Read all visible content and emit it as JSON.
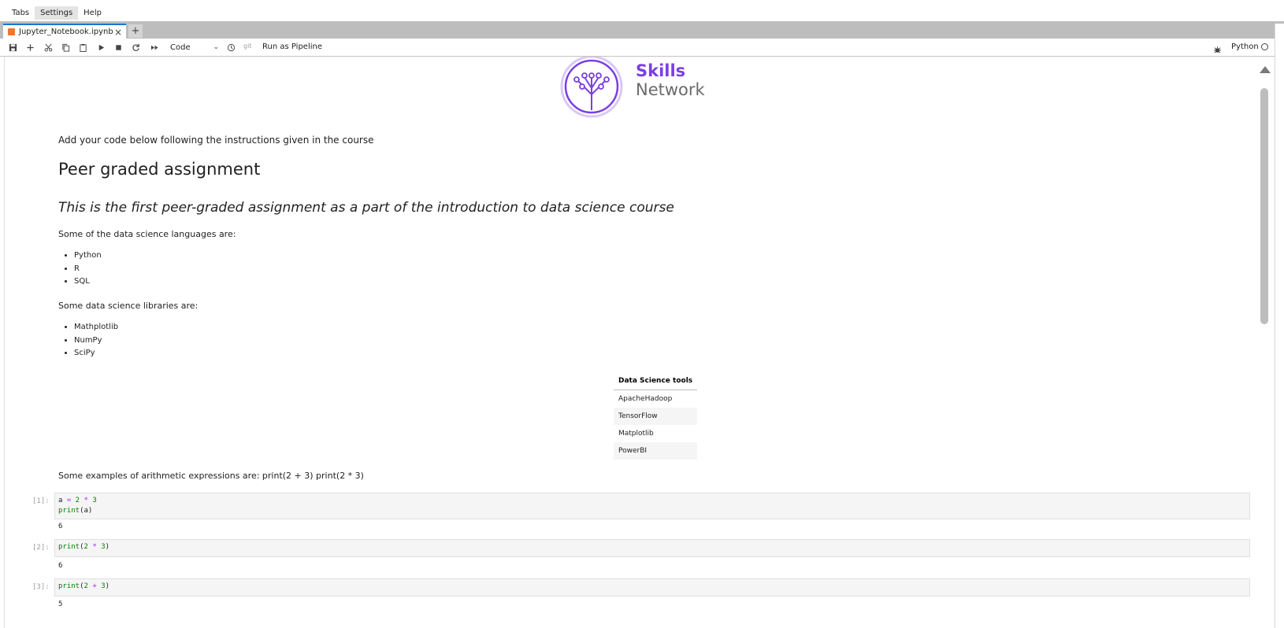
{
  "menubar": {
    "items": [
      {
        "label": "Tabs"
      },
      {
        "label": "Settings"
      },
      {
        "label": "Help"
      }
    ]
  },
  "tabs": {
    "active": {
      "label": "Jupyter_Notebook.ipynb",
      "close": "×"
    },
    "new_tab": "+"
  },
  "toolbar": {
    "cell_type": "Code",
    "git": "git",
    "run_pipeline": "Run as Pipeline",
    "kernel": "Python"
  },
  "logo": {
    "line1": "Skills",
    "line2": "Network"
  },
  "content": {
    "intro": "Add your code below following the instructions given in the course",
    "heading": "Peer graded assignment",
    "subheading": "This is the first peer-graded assignment as a part of the introduction to data science course",
    "languages_intro": "Some of the data science languages are:",
    "languages": [
      "Python",
      "R",
      "SQL"
    ],
    "libraries_intro": "Some data science libraries are:",
    "libraries": [
      "Mathplotlib",
      "NumPy",
      "SciPy"
    ],
    "tools_table": {
      "header": "Data Science tools",
      "rows": [
        "ApacheHadoop",
        "TensorFlow",
        "Matplotlib",
        "PowerBI"
      ]
    },
    "arith_intro": "Some examples of arithmetic expressions are: print(2 + 3) print(2 * 3)"
  },
  "cells": [
    {
      "prompt": "[1]:",
      "line1_a": "a ",
      "line1_eq": "=",
      "line1_n1": " 2 ",
      "line1_op": "*",
      "line1_n2": " 3",
      "line2_fn": "print",
      "line2_rest": "(a)",
      "output": "6"
    },
    {
      "prompt": "[2]:",
      "fn": "print",
      "open": "(",
      "n1": "2",
      "op": " * ",
      "n2": "3",
      "close": ")",
      "output": "6"
    },
    {
      "prompt": "[3]:",
      "fn": "print",
      "open": "(",
      "n1": "2",
      "op": " + ",
      "n2": "3",
      "close": ")",
      "output": "5"
    }
  ],
  "colors": {
    "accent": "#1976d2",
    "logo_purple": "#7b3fe4",
    "cell_bg": "#f5f5f5"
  }
}
